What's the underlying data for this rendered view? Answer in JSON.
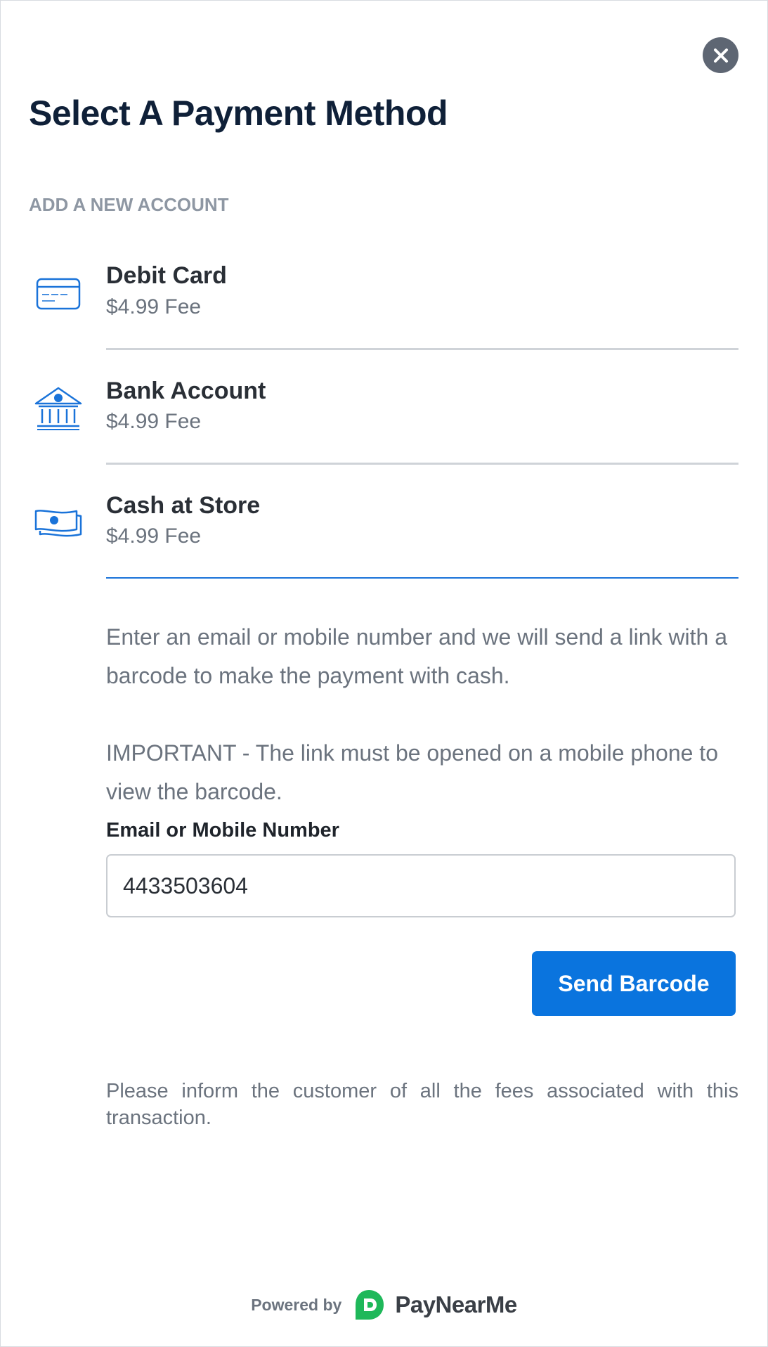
{
  "dialog": {
    "title": "Select A Payment Method",
    "close_icon": "close-icon"
  },
  "section": {
    "label": "ADD A NEW ACCOUNT"
  },
  "options": [
    {
      "label": "Debit Card",
      "fee": "$4.99 Fee",
      "icon": "credit-card-icon"
    },
    {
      "label": "Bank Account",
      "fee": "$4.99 Fee",
      "icon": "bank-icon"
    },
    {
      "label": "Cash at Store",
      "fee": "$4.99 Fee",
      "icon": "cash-icon",
      "selected": true
    }
  ],
  "cash_panel": {
    "instructions": "Enter an email or mobile number and we will send a link with a barcode to make the payment with cash.",
    "important": "IMPORTANT - The link must be opened on a mobile phone to view the barcode.",
    "field_label": "Email or Mobile Number",
    "field_value": "4433503604",
    "send_label": "Send Barcode"
  },
  "disclaimer": "Please inform the customer of all the fees associated with this transaction.",
  "footer": {
    "powered_by": "Powered by",
    "brand": "PayNearMe",
    "brand_icon": "paynearme-logo-icon"
  },
  "colors": {
    "accent": "#0a74de",
    "title": "#0f2038",
    "muted": "#6b737e",
    "brand_green": "#1fb85a"
  }
}
